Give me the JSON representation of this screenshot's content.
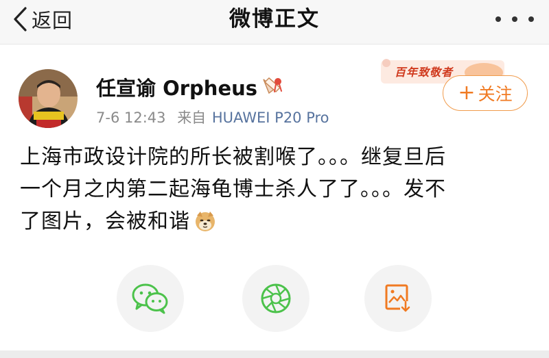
{
  "header": {
    "back_label": "返回",
    "title": "微博正文"
  },
  "post": {
    "username": "任宣谕 Orpheus",
    "timestamp": "7-6 12:43",
    "from_label": "来自",
    "device": "HUAWEI P20 Pro",
    "follow_label": "关注",
    "decoration_text": "百年致敬者",
    "content_lines": [
      "上海市政设计院的所长被割喉了。。。继复旦后",
      "一个月之内第二起海龟博士杀人了了。。。发不",
      "了图片，会被和谐"
    ]
  },
  "share_actions": [
    "wechat",
    "moments",
    "save-image"
  ],
  "colors": {
    "accent_orange": "#f07a22",
    "device_link": "#57739e",
    "meta_gray": "#8a8a8a",
    "wechat_green": "#4cc24b"
  }
}
